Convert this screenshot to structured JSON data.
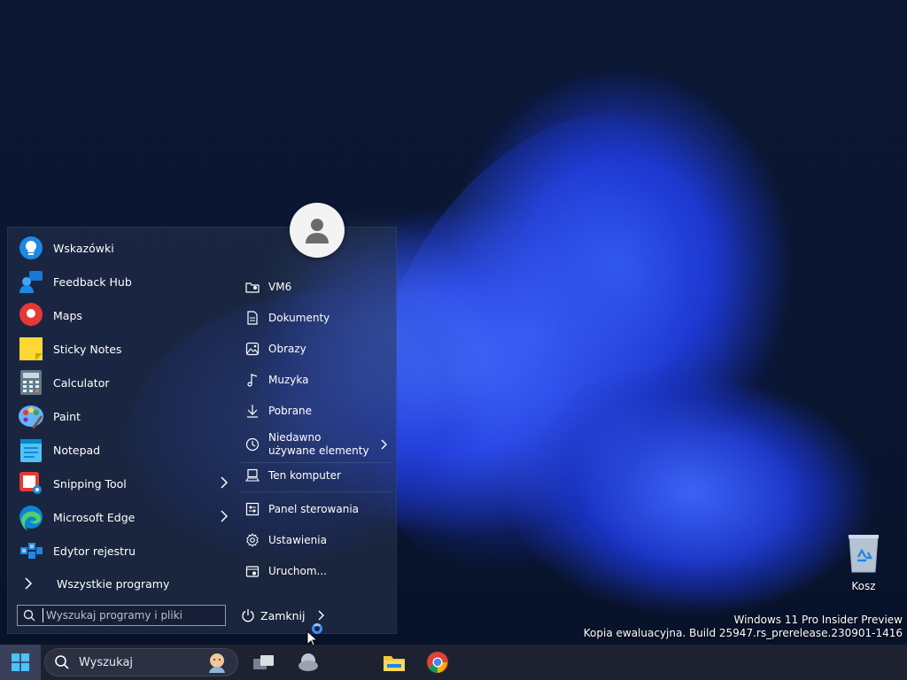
{
  "apps": [
    {
      "label": "Wskazówki",
      "icon": "tips-icon",
      "has_arrow": false
    },
    {
      "label": "Feedback Hub",
      "icon": "feedback-hub-icon",
      "has_arrow": false
    },
    {
      "label": "Maps",
      "icon": "maps-icon",
      "has_arrow": false
    },
    {
      "label": "Sticky Notes",
      "icon": "sticky-notes-icon",
      "has_arrow": false
    },
    {
      "label": "Calculator",
      "icon": "calculator-icon",
      "has_arrow": false
    },
    {
      "label": "Paint",
      "icon": "paint-icon",
      "has_arrow": false
    },
    {
      "label": "Notepad",
      "icon": "notepad-icon",
      "has_arrow": false
    },
    {
      "label": "Snipping Tool",
      "icon": "snipping-tool-icon",
      "has_arrow": true
    },
    {
      "label": "Microsoft Edge",
      "icon": "edge-icon",
      "has_arrow": true
    },
    {
      "label": "Edytor rejestru",
      "icon": "registry-editor-icon",
      "has_arrow": false
    }
  ],
  "all_programs": "Wszystkie programy",
  "search": {
    "placeholder": "Wyszukaj programy i pliki"
  },
  "places": [
    {
      "label": "VM6",
      "icon": "user-folder-icon"
    },
    {
      "label": "Dokumenty",
      "icon": "document-icon"
    },
    {
      "label": "Obrazy",
      "icon": "pictures-icon"
    },
    {
      "label": "Muzyka",
      "icon": "music-icon"
    },
    {
      "label": "Pobrane",
      "icon": "download-icon"
    },
    {
      "label": "Niedawno używane elementy",
      "icon": "recent-icon"
    },
    {
      "label": "Ten komputer",
      "icon": "computer-icon"
    },
    {
      "label": "Panel sterowania",
      "icon": "control-panel-icon"
    },
    {
      "label": "Ustawienia",
      "icon": "settings-icon"
    },
    {
      "label": "Uruchom...",
      "icon": "run-icon"
    }
  ],
  "power": {
    "label": "Zamknij"
  },
  "desktop": {
    "recycle_bin": "Kosz"
  },
  "watermark": {
    "line1": "Windows 11 Pro Insider Preview",
    "line2": "Kopia ewaluacyjna. Build 25947.rs_prerelease.230901-1416"
  },
  "taskbar": {
    "search_label": "Wyszukaj"
  },
  "colors": {
    "accent": "#3b8bff",
    "taskbar": "#1e2230"
  }
}
